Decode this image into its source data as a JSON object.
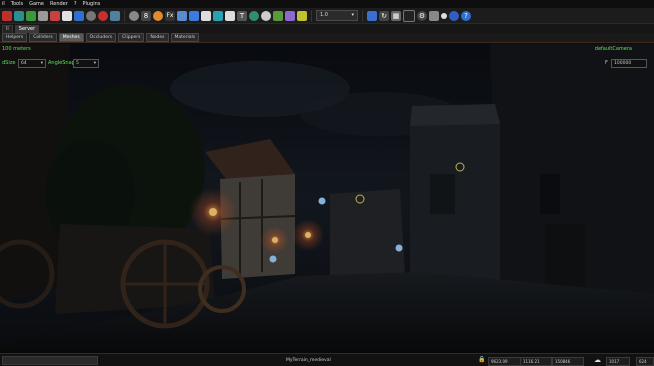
{
  "menu": [
    "il",
    "Tools",
    "Game",
    "Render",
    "?",
    "Plugins"
  ],
  "toolbar": {
    "icons": [
      "red-square-icon",
      "teal-square-icon",
      "green-square-icon",
      "save-icon",
      "red-doc-icon",
      "file-icon",
      "blue-square-icon",
      "settings-icon",
      "red-circle-icon",
      "bird-icon",
      "material-ball-icon",
      "b-icon",
      "orange-ball-icon",
      "fx-icon",
      "link-icon",
      "flag-icon",
      "new-icon",
      "snap-icon",
      "magnet-icon",
      "text-icon",
      "globe-icon",
      "circle-icon",
      "palette-icon",
      "grid-icon",
      "layer-icon"
    ],
    "speed_select": "1.0",
    "right_icons": [
      "undo-icon",
      "rotate-icon",
      "grid-icon",
      "render-icon",
      "gear-icon",
      "window-icon",
      "dot-icon",
      "globe-icon",
      "help-icon"
    ]
  },
  "tabs_top": [
    {
      "label": "ll",
      "active": false
    },
    {
      "label": "Server",
      "active": true
    }
  ],
  "tabs_filter": [
    {
      "label": "Helpers",
      "active": false
    },
    {
      "label": "Colliders",
      "active": false
    },
    {
      "label": "Meshes",
      "active": true
    },
    {
      "label": "Occluders",
      "active": false
    },
    {
      "label": "Clippers",
      "active": false
    },
    {
      "label": "Nodes",
      "active": false
    },
    {
      "label": "Materials",
      "active": false
    }
  ],
  "viewport": {
    "distance_text": "100 meters",
    "camera_name": "defaultCamera",
    "grid_label": "dSize",
    "grid_value": "64",
    "angle_label": "AngleSnap",
    "angle_value": "5",
    "far_label": "F",
    "far_value": "100000"
  },
  "status": {
    "level_name": "MyTerrain_medieval",
    "fields": [
      "9623.09",
      "1116.21",
      "150846",
      "1017",
      "624"
    ]
  }
}
